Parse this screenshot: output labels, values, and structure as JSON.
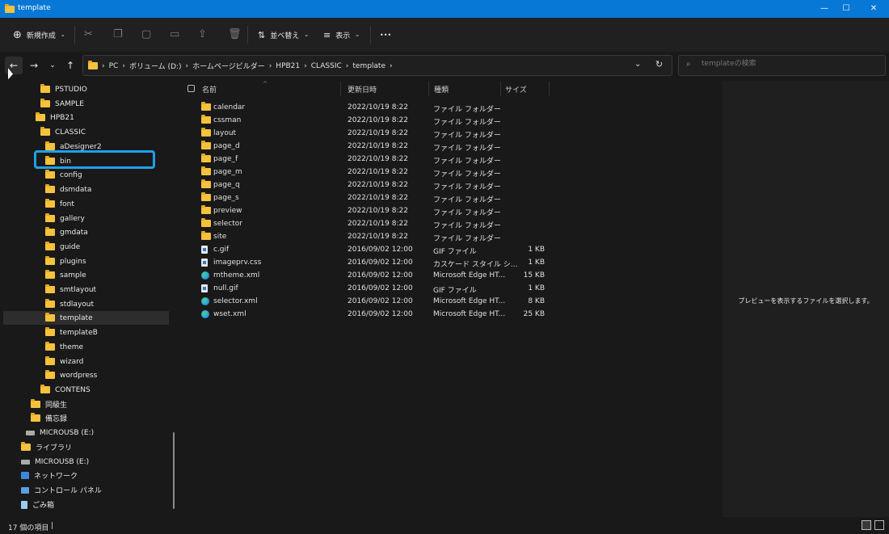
{
  "window": {
    "title": "template",
    "controls": {
      "minimize": "—",
      "maximize": "☐",
      "close": "✕"
    }
  },
  "toolbar": {
    "new_label": "新規作成",
    "sort_label": "並べ替え",
    "view_label": "表示",
    "more_label": "•••"
  },
  "address": {
    "crumbs": [
      "PC",
      "ボリューム (D:)",
      "ホームページビルダー",
      "HPB21",
      "CLASSIC",
      "template"
    ],
    "search_placeholder": "templateの検索"
  },
  "navpane": {
    "items": [
      {
        "label": "PSTUDIO",
        "icon": "folder-icon"
      },
      {
        "label": "SAMPLE",
        "icon": "folder-icon"
      },
      {
        "label": "HPB21",
        "icon": "folder-icon"
      },
      {
        "label": "CLASSIC",
        "icon": "folder-icon"
      },
      {
        "label": "aDesigner2",
        "icon": "folder-icon"
      },
      {
        "label": "bin",
        "icon": "folder-icon"
      },
      {
        "label": "config",
        "icon": "folder-icon"
      },
      {
        "label": "dsmdata",
        "icon": "folder-icon"
      },
      {
        "label": "font",
        "icon": "folder-icon"
      },
      {
        "label": "gallery",
        "icon": "folder-icon"
      },
      {
        "label": "gmdata",
        "icon": "folder-icon"
      },
      {
        "label": "guide",
        "icon": "folder-icon"
      },
      {
        "label": "plugins",
        "icon": "folder-icon"
      },
      {
        "label": "sample",
        "icon": "folder-icon"
      },
      {
        "label": "smtlayout",
        "icon": "folder-icon"
      },
      {
        "label": "stdlayout",
        "icon": "folder-icon"
      },
      {
        "label": "template",
        "icon": "folder-icon"
      },
      {
        "label": "templateB",
        "icon": "folder-icon"
      },
      {
        "label": "theme",
        "icon": "folder-icon"
      },
      {
        "label": "wizard",
        "icon": "folder-icon"
      },
      {
        "label": "wordpress",
        "icon": "folder-icon"
      },
      {
        "label": "CONTENS",
        "icon": "folder-icon"
      },
      {
        "label": "同級生",
        "icon": "folder-icon"
      },
      {
        "label": "備忘録",
        "icon": "folder-icon"
      },
      {
        "label": "MICROUSB (E:)",
        "icon": "drive-icon"
      },
      {
        "label": "ライブラリ",
        "icon": "library-icon"
      },
      {
        "label": "MICROUSB (E:)",
        "icon": "drive-icon"
      },
      {
        "label": "ネットワーク",
        "icon": "network-icon"
      },
      {
        "label": "コントロール パネル",
        "icon": "control-panel-icon"
      },
      {
        "label": "ごみ箱",
        "icon": "recycle-bin-icon"
      }
    ]
  },
  "columns": {
    "name": "名前",
    "date": "更新日時",
    "type": "種類",
    "size": "サイズ"
  },
  "files": [
    {
      "name": "calendar",
      "date": "2022/10/19 8:22",
      "type": "ファイル フォルダー",
      "size": "",
      "icon": "folder-icon"
    },
    {
      "name": "cssman",
      "date": "2022/10/19 8:22",
      "type": "ファイル フォルダー",
      "size": "",
      "icon": "folder-icon"
    },
    {
      "name": "layout",
      "date": "2022/10/19 8:22",
      "type": "ファイル フォルダー",
      "size": "",
      "icon": "folder-icon"
    },
    {
      "name": "page_d",
      "date": "2022/10/19 8:22",
      "type": "ファイル フォルダー",
      "size": "",
      "icon": "folder-icon"
    },
    {
      "name": "page_f",
      "date": "2022/10/19 8:22",
      "type": "ファイル フォルダー",
      "size": "",
      "icon": "folder-icon"
    },
    {
      "name": "page_m",
      "date": "2022/10/19 8:22",
      "type": "ファイル フォルダー",
      "size": "",
      "icon": "folder-icon"
    },
    {
      "name": "page_q",
      "date": "2022/10/19 8:22",
      "type": "ファイル フォルダー",
      "size": "",
      "icon": "folder-icon"
    },
    {
      "name": "page_s",
      "date": "2022/10/19 8:22",
      "type": "ファイル フォルダー",
      "size": "",
      "icon": "folder-icon"
    },
    {
      "name": "preview",
      "date": "2022/10/19 8:22",
      "type": "ファイル フォルダー",
      "size": "",
      "icon": "folder-icon"
    },
    {
      "name": "selector",
      "date": "2022/10/19 8:22",
      "type": "ファイル フォルダー",
      "size": "",
      "icon": "folder-icon"
    },
    {
      "name": "site",
      "date": "2022/10/19 8:22",
      "type": "ファイル フォルダー",
      "size": "",
      "icon": "folder-icon"
    },
    {
      "name": "c.gif",
      "date": "2016/09/02 12:00",
      "type": "GIF ファイル",
      "size": "1 KB",
      "icon": "gif-file-icon"
    },
    {
      "name": "imageprv.css",
      "date": "2016/09/02 12:00",
      "type": "カスケード スタイル シ...",
      "size": "1 KB",
      "icon": "css-file-icon"
    },
    {
      "name": "mtheme.xml",
      "date": "2016/09/02 12:00",
      "type": "Microsoft Edge HT...",
      "size": "15 KB",
      "icon": "edge-file-icon"
    },
    {
      "name": "null.gif",
      "date": "2016/09/02 12:00",
      "type": "GIF ファイル",
      "size": "1 KB",
      "icon": "gif-file-icon"
    },
    {
      "name": "selector.xml",
      "date": "2016/09/02 12:00",
      "type": "Microsoft Edge HT...",
      "size": "8 KB",
      "icon": "edge-file-icon"
    },
    {
      "name": "wset.xml",
      "date": "2016/09/02 12:00",
      "type": "Microsoft Edge HT...",
      "size": "25 KB",
      "icon": "edge-file-icon"
    }
  ],
  "preview": {
    "message": "プレビューを表示するファイルを選択します。"
  },
  "status": {
    "count": "17 個の項目",
    "separator": "|"
  },
  "colors": {
    "accent": "#0878d6",
    "highlight": "#1ea0e8",
    "folder": "#f4c23d"
  }
}
